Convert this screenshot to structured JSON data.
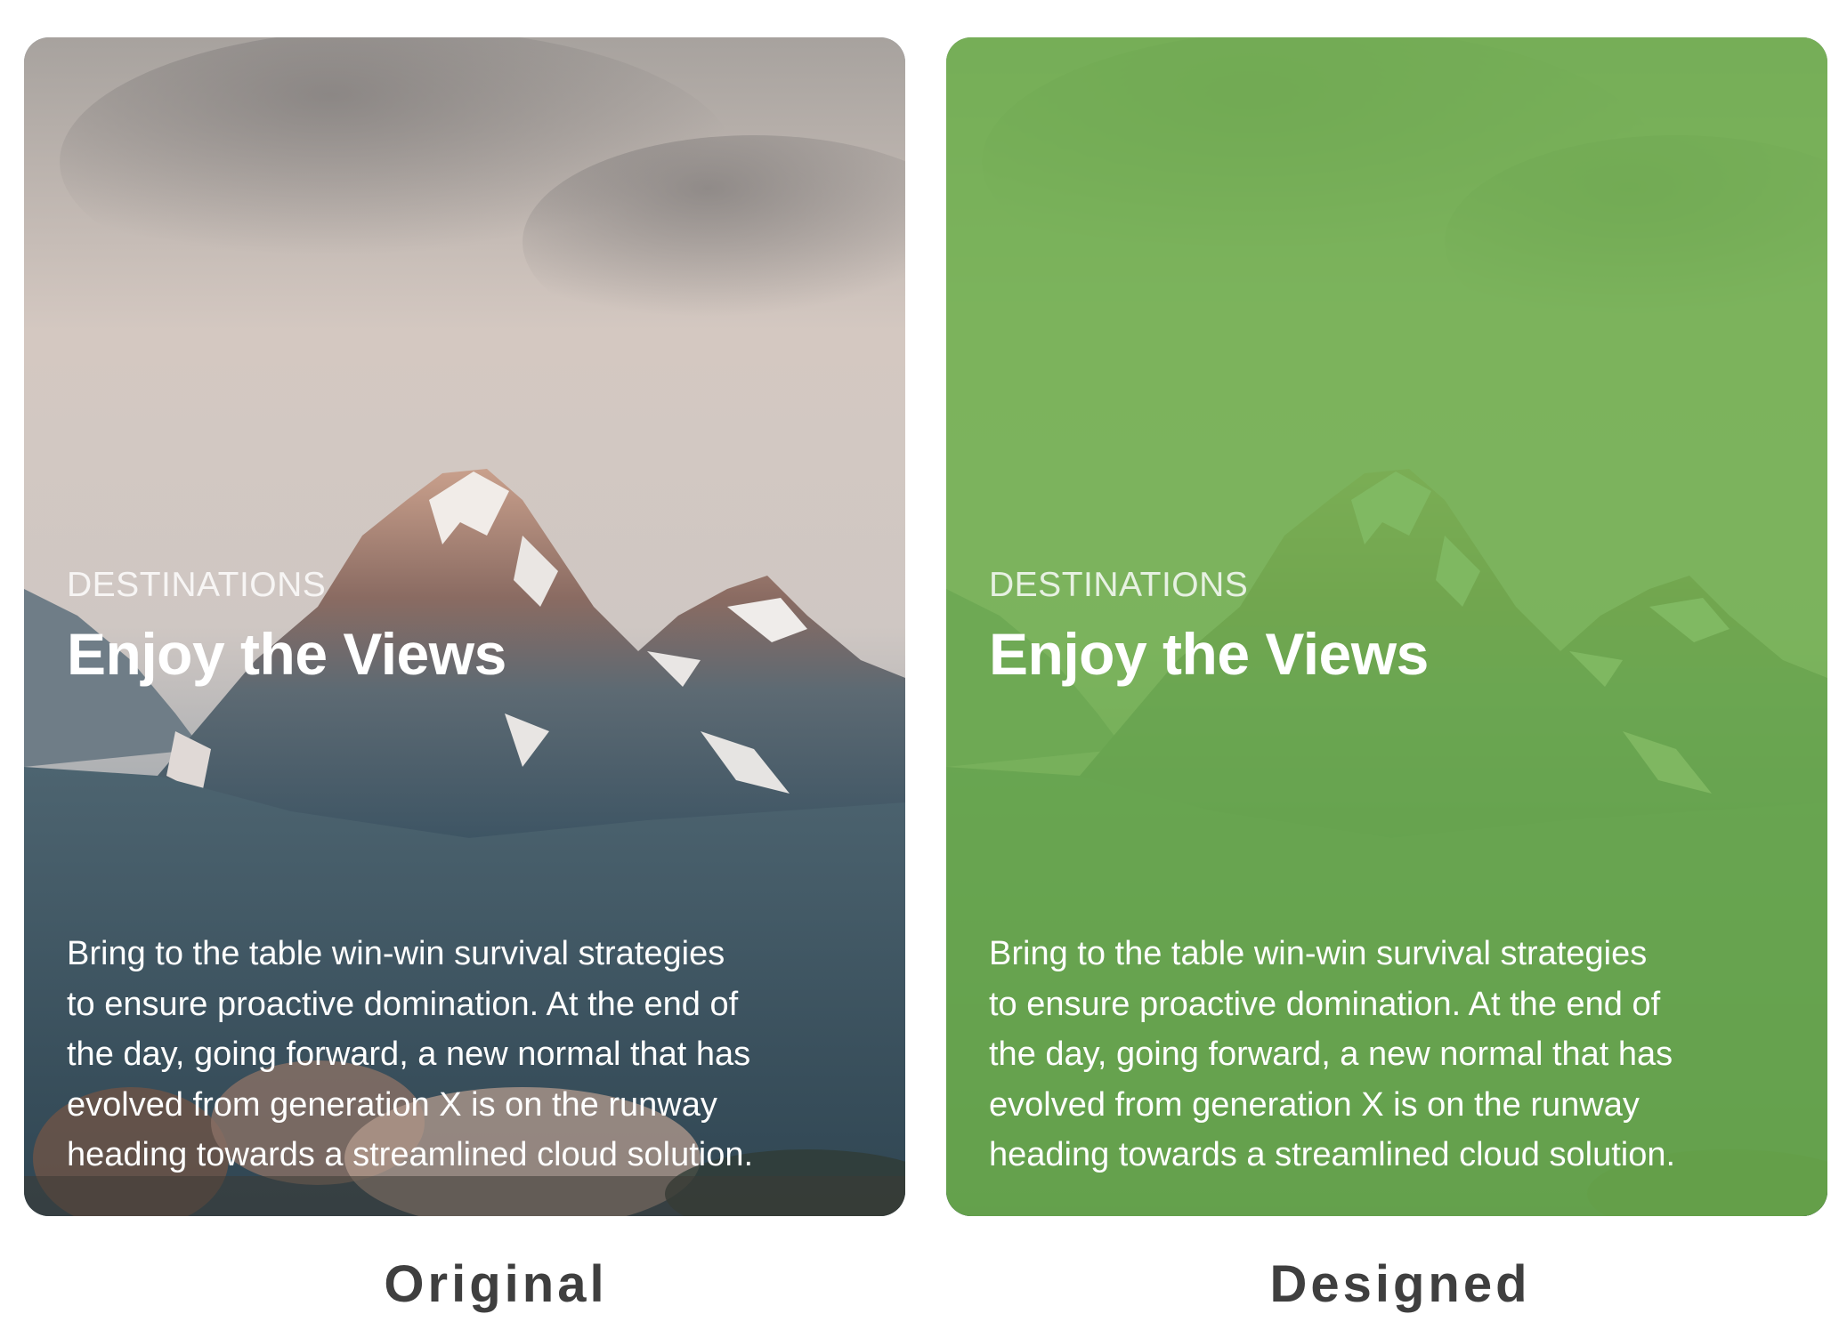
{
  "colors": {
    "overlay_green": "#6db04c",
    "caption_text": "#3f3f3f",
    "card_text": "#ffffff"
  },
  "cards": [
    {
      "variant": "original",
      "eyebrow": "DESTINATIONS",
      "title": "Enjoy the Views",
      "body_lines": [
        "Bring to the table win-win survival strategies",
        "to ensure proactive domination. At the end of",
        "the day, going forward, a new normal that has",
        "evolved from generation X is on the runway",
        "heading towards a streamlined cloud solution."
      ],
      "caption": "Original"
    },
    {
      "variant": "designed",
      "eyebrow": "DESTINATIONS",
      "title": "Enjoy the Views",
      "body_lines": [
        "Bring to the table win-win survival strategies",
        "to ensure proactive domination. At the end of",
        "the day, going forward, a new normal that has",
        "evolved from generation X is on the runway",
        "heading towards a streamlined cloud solution."
      ],
      "caption": "Designed"
    }
  ]
}
